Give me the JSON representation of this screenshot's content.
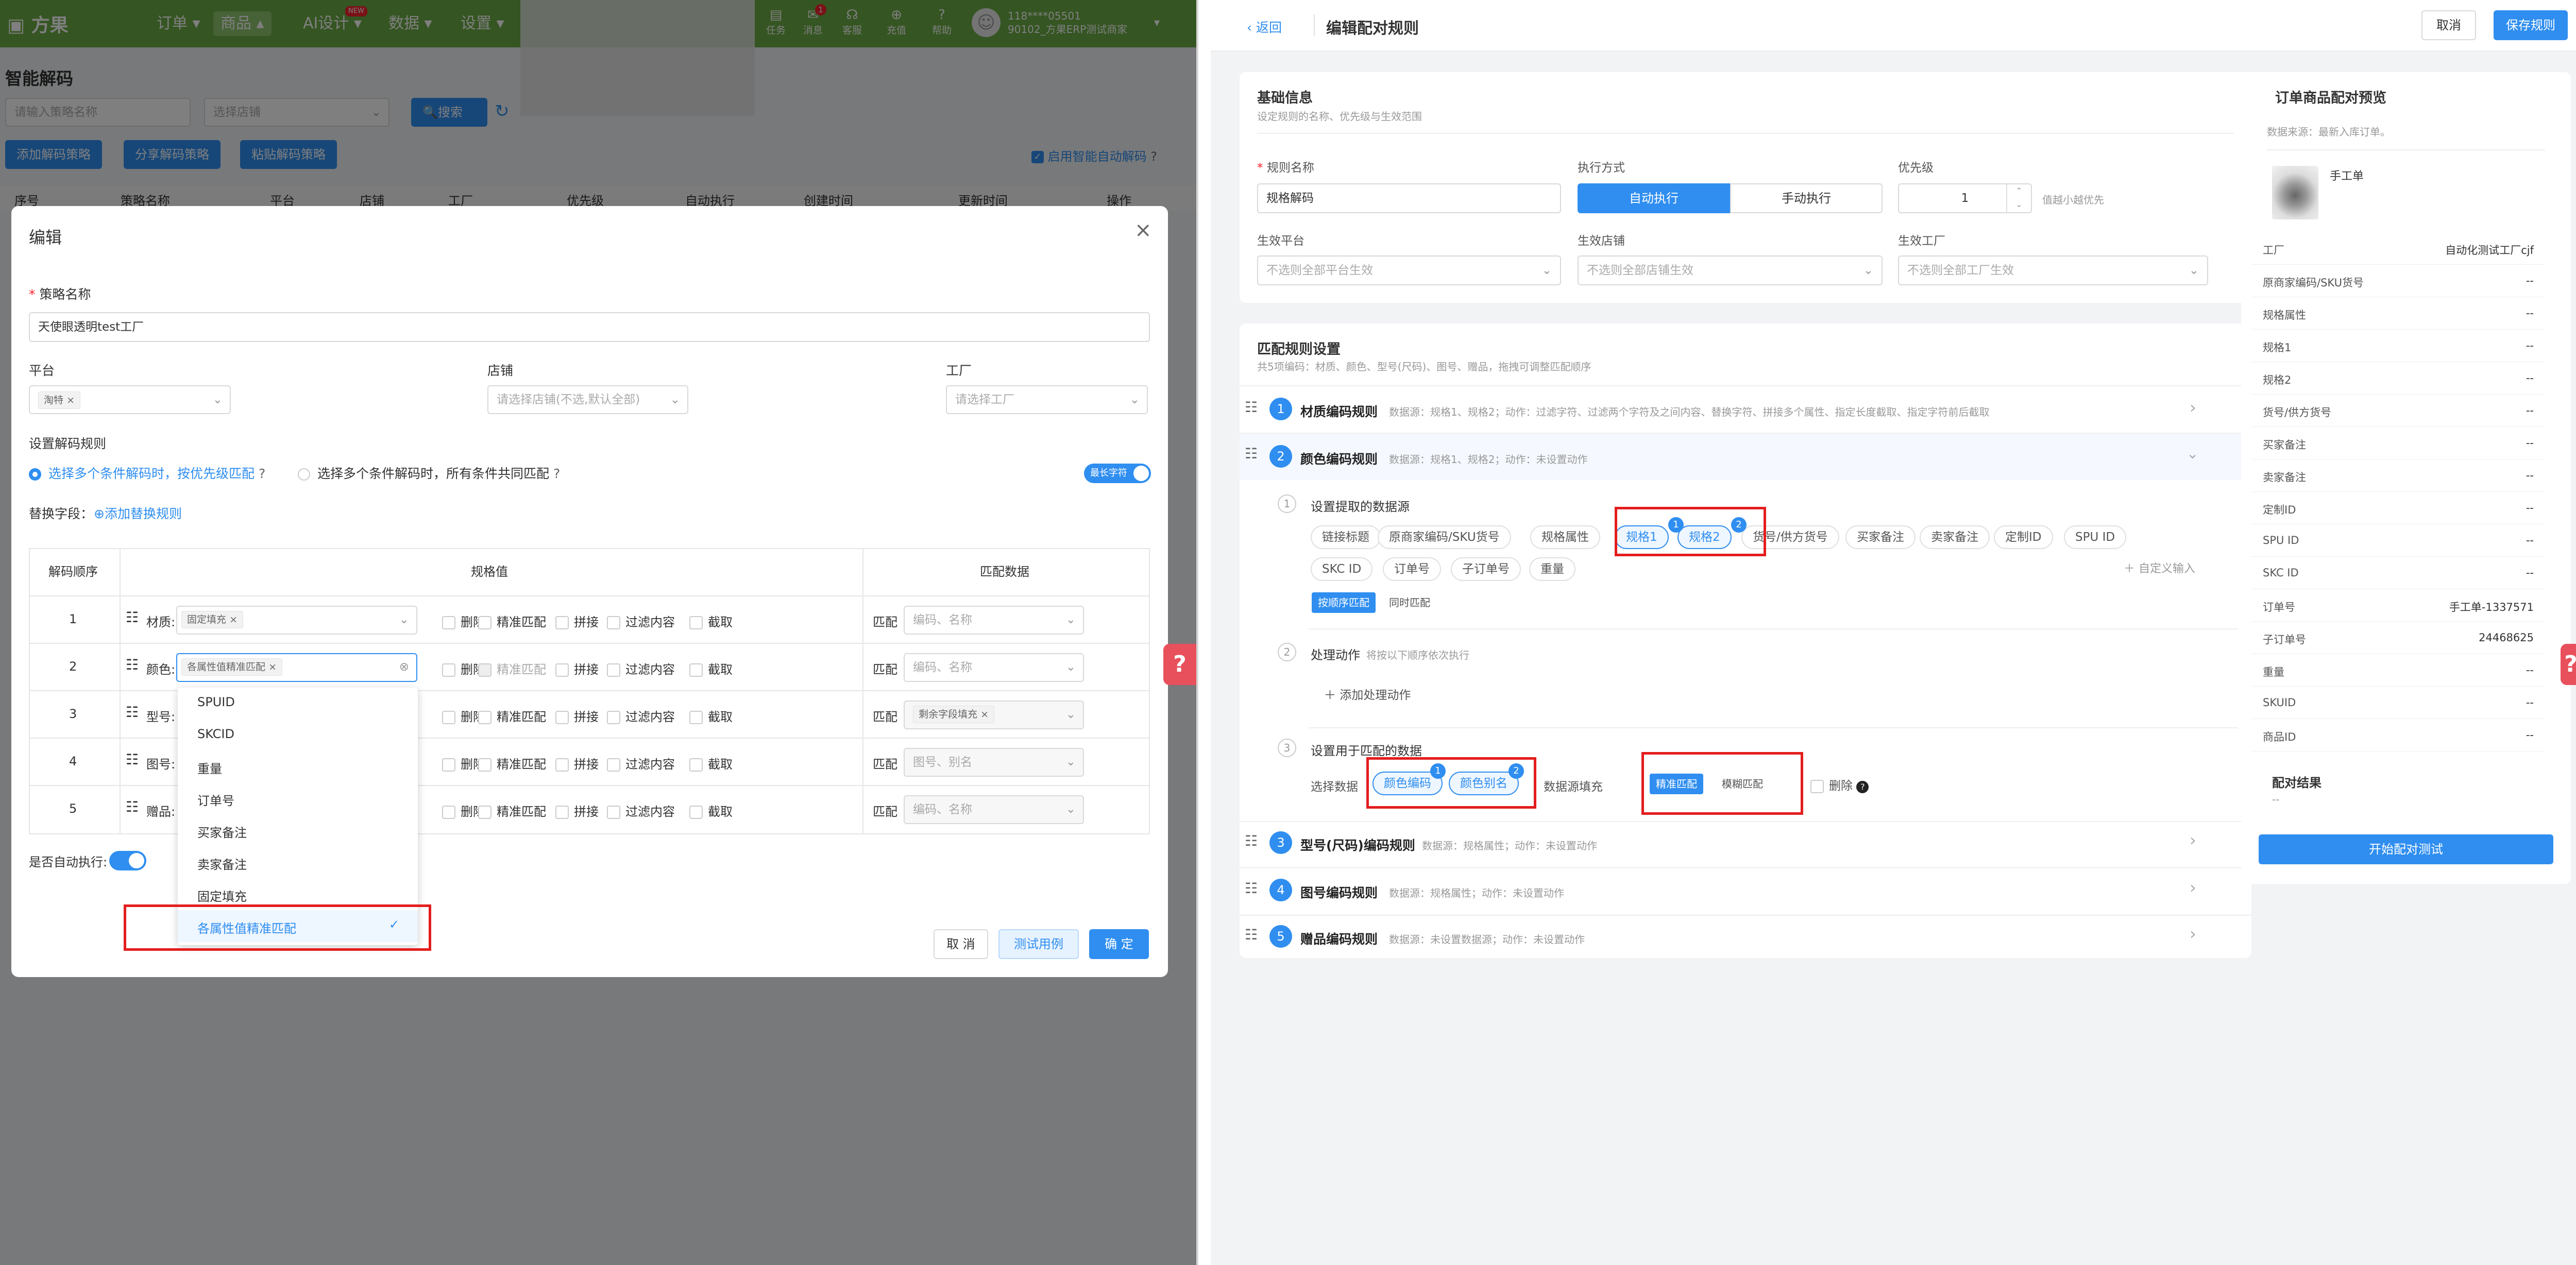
{
  "topbar": {
    "brand": "方果",
    "nav": [
      "订单 ▾",
      "商品 ▴",
      "AI设计 ▾",
      "数据 ▾",
      "设置 ▾"
    ],
    "ai_badge": "NEW",
    "icons": [
      {
        "name": "任务",
        "glyph": "▤"
      },
      {
        "name": "消息",
        "glyph": "✉"
      },
      {
        "name": "客服",
        "glyph": "☊"
      },
      {
        "name": "充值",
        "glyph": "⊕"
      },
      {
        "name": "帮助",
        "glyph": "?"
      }
    ],
    "msg_count": "1",
    "user_phone": "118****05501",
    "user_org": "90102_方果ERP测试商家"
  },
  "page": {
    "title": "智能解码",
    "search_placeholder": "请输入策略名称",
    "shop_placeholder": "选择店铺",
    "search_btn": "搜索",
    "btn_add": "添加解码策略",
    "btn_share": "分享解码策略",
    "btn_paste": "粘贴解码策略",
    "auto_decode": "启用智能自动解码",
    "columns": [
      "序号",
      "策略名称",
      "平台",
      "店铺",
      "工厂",
      "优先级",
      "自动执行",
      "创建时间",
      "更新时间",
      "操作"
    ]
  },
  "modal": {
    "title": "编辑",
    "name_label": "策略名称",
    "name_value": "天使眼透明test工厂",
    "platform_label": "平台",
    "platform_tag": "淘特",
    "shop_label": "店铺",
    "shop_placeholder": "请选择店铺(不选,默认全部)",
    "factory_label": "工厂",
    "factory_placeholder": "请选择工厂",
    "rule_label": "设置解码规则",
    "radio1": "选择多个条件解码时，按优先级匹配",
    "radio2": "选择多个条件解码时，所有条件共同匹配",
    "toggle_label": "最长字符",
    "replace_label": "替换字段：",
    "add_replace": "添加替换规则",
    "th_order": "解码顺序",
    "th_spec": "规格值",
    "th_match": "匹配数据",
    "rows": [
      {
        "order": "1",
        "name": "材质:",
        "tag": "固定填充",
        "match_label": "匹配",
        "match_tag": "",
        "match_ph": "编码、名称"
      },
      {
        "order": "2",
        "name": "颜色:",
        "tag": "各属性值精准匹配",
        "match_label": "匹配",
        "match_tag": "",
        "match_ph": "编码、名称"
      },
      {
        "order": "3",
        "name": "型号:",
        "tag": "",
        "match_label": "匹配",
        "match_tag": "剩余字段填充",
        "match_ph": ""
      },
      {
        "order": "4",
        "name": "图号:",
        "tag": "",
        "match_label": "匹配",
        "match_tag": "",
        "match_ph": "图号、别名"
      },
      {
        "order": "5",
        "name": "赠品:",
        "tag": "",
        "match_label": "匹配",
        "match_tag": "",
        "match_ph": "编码、名称"
      }
    ],
    "opts": [
      "删除",
      "精准匹配",
      "拼接",
      "过滤内容",
      "截取"
    ],
    "auto_exec": "是否自动执行:",
    "dropdown": [
      "SPUID",
      "SKCID",
      "重量",
      "订单号",
      "买家备注",
      "卖家备注",
      "固定填充",
      "各属性值精准匹配"
    ],
    "btn_cancel": "取 消",
    "btn_test": "测试用例",
    "btn_ok": "确 定"
  },
  "right": {
    "back": "返回",
    "title": "编辑配对规则",
    "cancel": "取消",
    "save": "保存规则",
    "basic_title": "基础信息",
    "basic_sub": "设定规则的名称、优先级与生效范围",
    "rule_name_label": "规则名称",
    "rule_name_value": "规格解码",
    "exec_label": "执行方式",
    "exec_auto": "自动执行",
    "exec_manual": "手动执行",
    "priority_label": "优先级",
    "priority_value": "1",
    "priority_hint": "值越小越优先",
    "platform_label": "生效平台",
    "platform_ph": "不选则全部平台生效",
    "shop_label": "生效店铺",
    "shop_ph": "不选则全部店铺生效",
    "factory_label": "生效工厂",
    "factory_ph": "不选则全部工厂生效",
    "match_title": "匹配规则设置",
    "match_sub": "共5项编码：材质、颜色、型号(尺码)、图号、赠品，拖拽可调整匹配顺序",
    "rules": [
      {
        "n": "1",
        "title": "材质编码规则",
        "sub": "数据源：规格1、规格2；动作：过滤字符、过滤两个字符及之间内容、替换字符、拼接多个属性、指定长度截取、指定字符前后截取"
      },
      {
        "n": "2",
        "title": "颜色编码规则",
        "sub": "数据源：规格1、规格2；动作：未设置动作"
      },
      {
        "n": "3",
        "title": "型号(尺码)编码规则",
        "sub": "数据源：规格属性；动作：未设置动作"
      },
      {
        "n": "4",
        "title": "图号编码规则",
        "sub": "数据源：规格属性；动作：未设置动作"
      },
      {
        "n": "5",
        "title": "赠品编码规则",
        "sub": "数据源：未设置数据源；动作：未设置动作"
      }
    ],
    "step1": "设置提取的数据源",
    "chips_row1": [
      "链接标题",
      "原商家编码/SKU货号",
      "规格属性",
      "规格1",
      "规格2",
      "货号/供方货号",
      "买家备注",
      "卖家备注",
      "定制ID",
      "SPU ID"
    ],
    "chips_row2": [
      "SKC ID",
      "订单号",
      "子订单号",
      "重量"
    ],
    "custom_input": "自定义输入",
    "seq_match": "按顺序匹配",
    "same_match": "同时匹配",
    "step2": "处理动作",
    "step2_sub": "将按以下顺序依次执行",
    "add_action": "添加处理动作",
    "step3": "设置用于匹配的数据",
    "select_data": "选择数据",
    "data_chip1": "颜色编码",
    "data_chip2": "颜色别名",
    "data_fill": "数据源填充",
    "exact": "精准匹配",
    "fuzzy": "模糊匹配",
    "delete": "删除",
    "preview_title": "订单商品配对预览",
    "preview_sub": "数据来源：最新入库订单。",
    "product_name": "手工单",
    "preview_rows": [
      {
        "k": "工厂",
        "v": "自动化测试工厂cjf"
      },
      {
        "k": "原商家编码/SKU货号",
        "v": "--"
      },
      {
        "k": "规格属性",
        "v": "--"
      },
      {
        "k": "规格1",
        "v": "--"
      },
      {
        "k": "规格2",
        "v": "--"
      },
      {
        "k": "货号/供方货号",
        "v": "--"
      },
      {
        "k": "买家备注",
        "v": "--"
      },
      {
        "k": "卖家备注",
        "v": "--"
      },
      {
        "k": "定制ID",
        "v": "--"
      },
      {
        "k": "SPU ID",
        "v": "--"
      },
      {
        "k": "SKC ID",
        "v": "--"
      },
      {
        "k": "订单号",
        "v": "手工单-1337571"
      },
      {
        "k": "子订单号",
        "v": "24468625"
      },
      {
        "k": "重量",
        "v": "--"
      },
      {
        "k": "SKUID",
        "v": "--"
      },
      {
        "k": "商品ID",
        "v": "--"
      }
    ],
    "result_label": "配对结果",
    "result_value": "--",
    "start_btn": "开始配对测试"
  },
  "colors": {
    "primary": "#2f8ef0",
    "topbar": "#6aab45",
    "highlight": "#e41d1d"
  }
}
